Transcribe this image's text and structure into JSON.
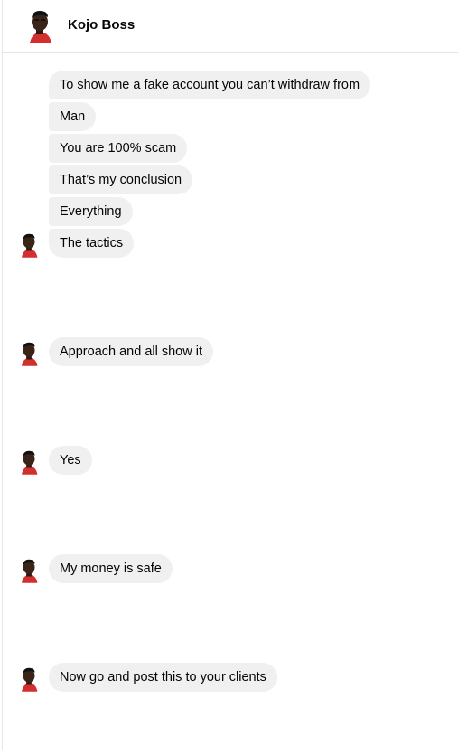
{
  "contact": {
    "name": "Kojo Boss"
  },
  "messages": [
    "To show me a fake account you can’t withdraw from",
    "Man",
    "You are 100% scam",
    "That’s my conclusion",
    "Everything",
    "The tactics",
    "Approach and all show it",
    "Yes",
    "My money is safe",
    "Now go and post this to your clients"
  ],
  "colors": {
    "bubble": "#f0f0f0",
    "text": "#050505",
    "divider": "#e4e6eb"
  },
  "icons": {
    "avatar": "user-avatar-icon"
  }
}
